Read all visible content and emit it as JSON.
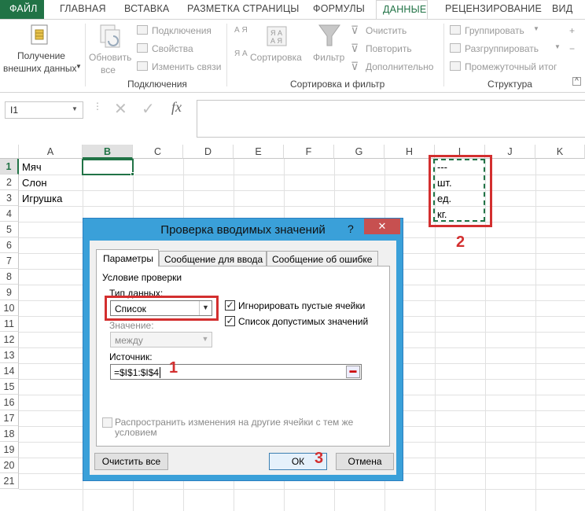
{
  "ribbon": {
    "tabs": [
      "ФАЙЛ",
      "ГЛАВНАЯ",
      "ВСТАВКА",
      "РАЗМЕТКА СТРАНИЦЫ",
      "ФОРМУЛЫ",
      "ДАННЫЕ",
      "РЕЦЕНЗИРОВАНИЕ",
      "ВИД"
    ],
    "get_external_data": [
      "Получение",
      "внешних данных"
    ],
    "refresh_all": [
      "Обновить",
      "все"
    ],
    "connections": "Подключения",
    "properties": "Свойства",
    "edit_links": "Изменить связи",
    "group_connections": "Подключения",
    "sort": "Сортировка",
    "filter": "Фильтр",
    "clear": "Очистить",
    "reapply": "Повторить",
    "advanced": "Дополнительно",
    "group_sort_filter": "Сортировка и фильтр",
    "group_btn": "Группировать",
    "ungroup": "Разгруппировать",
    "subtotal": "Промежуточный итог",
    "group_outline": "Структура",
    "sort_az": "А Я",
    "sort_za": "Я А"
  },
  "formula_bar": {
    "name_box": "I1",
    "fx": "fx"
  },
  "columns": [
    "A",
    "B",
    "C",
    "D",
    "E",
    "F",
    "G",
    "H",
    "I",
    "J",
    "K"
  ],
  "rows": [
    "1",
    "2",
    "3",
    "4",
    "5",
    "6",
    "7",
    "8",
    "9",
    "10",
    "11",
    "12",
    "13",
    "14",
    "15",
    "16",
    "17",
    "18",
    "19",
    "20",
    "21"
  ],
  "cells": {
    "A1": "Мяч",
    "A2": "Слон",
    "A3": "Игрушка",
    "I1": "---",
    "I2": "шт.",
    "I3": "ед.",
    "I4": "кг."
  },
  "annotations": {
    "one": "1",
    "two": "2",
    "three": "3"
  },
  "dialog": {
    "title": "Проверка вводимых значений",
    "help": "?",
    "tabs": [
      "Параметры",
      "Сообщение для ввода",
      "Сообщение об ошибке"
    ],
    "section": "Условие проверки",
    "data_type_label": "Тип данных:",
    "data_type_value": "Список",
    "ignore_blank": "Игнорировать пустые ячейки",
    "in_cell_dropdown": "Список допустимых значений",
    "value_label": "Значение:",
    "value_value": "между",
    "source_label": "Источник:",
    "source_value": "=$I$1:$I$4",
    "apply_all": "Распространить изменения на другие ячейки с тем же условием",
    "clear_all": "Очистить все",
    "ok": "ОК",
    "cancel": "Отмена"
  },
  "colors": {
    "accent": "#217346",
    "dialog_frame": "#3aa0d9",
    "annotation": "#d32f2f",
    "close_btn": "#c75050"
  }
}
